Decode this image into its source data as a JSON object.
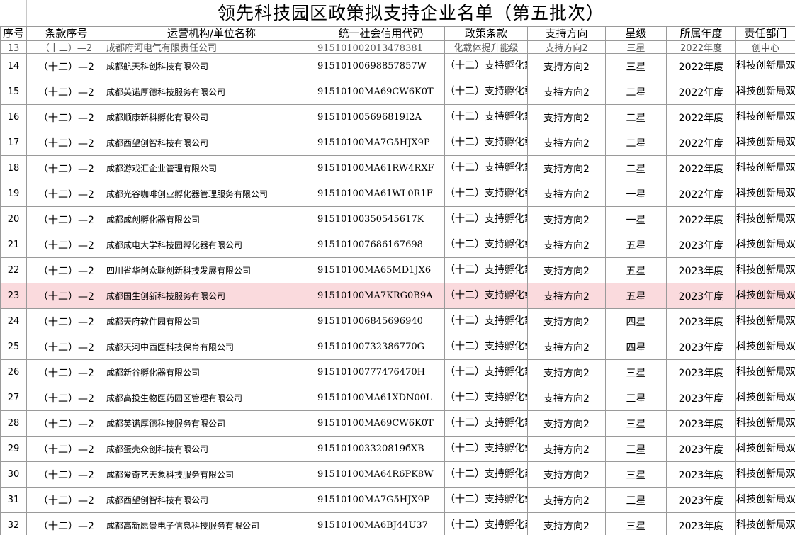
{
  "title": "领先科技园区政策拟支持企业名单（第五批次）",
  "headers": [
    "序号",
    "条款序号",
    "运营机构/单位名称",
    "统一社会信用代码",
    "政策条款",
    "支持方向",
    "星级",
    "所属年度",
    "责任部门"
  ],
  "partial_row": {
    "idx": "13",
    "clause": "（十二）—2",
    "name": "成都府河电气有限责任公司",
    "code": "915101002013478381",
    "terms": "化载体提升能级",
    "direction": "支持方向2",
    "star": "三星",
    "year": "2022年度",
    "dept": "创中心"
  },
  "rows": [
    {
      "idx": "14",
      "clause": "（十二）—2",
      "name": "成都航天科创科技有限公司",
      "code": "91510100698857857W",
      "terms": "（十二）支持孵化载体提升能级",
      "direction": "支持方向2",
      "star": "三星",
      "year": "2022年度",
      "dept": "科技创新局双创中心"
    },
    {
      "idx": "15",
      "clause": "（十二）—2",
      "name": "成都英诺厚德科技服务有限公司",
      "code": "91510100MA69CW6K0T",
      "terms": "（十二）支持孵化载体提升能级",
      "direction": "支持方向2",
      "star": "二星",
      "year": "2022年度",
      "dept": "科技创新局双创中心"
    },
    {
      "idx": "16",
      "clause": "（十二）—2",
      "name": "成都顺康新科孵化有限公司",
      "code": "915101005696819I2A",
      "terms": "（十二）支持孵化载体提升能级",
      "direction": "支持方向2",
      "star": "二星",
      "year": "2022年度",
      "dept": "科技创新局双创中心"
    },
    {
      "idx": "17",
      "clause": "（十二）—2",
      "name": "成都西望创智科技有限公司",
      "code": "91510100MA7G5HJX9P",
      "terms": "（十二）支持孵化载体提升能级",
      "direction": "支持方向2",
      "star": "二星",
      "year": "2022年度",
      "dept": "科技创新局双创中心"
    },
    {
      "idx": "18",
      "clause": "（十二）—2",
      "name": "成都游戏汇企业管理有限公司",
      "code": "91510100MA61RW4RXF",
      "terms": "（十二）支持孵化载体提升能级",
      "direction": "支持方向2",
      "star": "二星",
      "year": "2022年度",
      "dept": "科技创新局双创中心"
    },
    {
      "idx": "19",
      "clause": "（十二）—2",
      "name": "成都光谷咖啡创业孵化器管理服务有限公司",
      "code": "91510100MA61WL0R1F",
      "terms": "（十二）支持孵化载体提升能级",
      "direction": "支持方向2",
      "star": "一星",
      "year": "2022年度",
      "dept": "科技创新局双创中心"
    },
    {
      "idx": "20",
      "clause": "（十二）—2",
      "name": "成都成创孵化器有限公司",
      "code": "91510100350545617K",
      "terms": "（十二）支持孵化载体提升能级",
      "direction": "支持方向2",
      "star": "一星",
      "year": "2022年度",
      "dept": "科技创新局双创中心"
    },
    {
      "idx": "21",
      "clause": "（十二）—2",
      "name": "成都成电大学科技园孵化器有限公司",
      "code": "915101007686167698",
      "terms": "（十二）支持孵化载体提升能级",
      "direction": "支持方向2",
      "star": "五星",
      "year": "2023年度",
      "dept": "科技创新局双创中心"
    },
    {
      "idx": "22",
      "clause": "（十二）—2",
      "name": "四川省华创众联创新科技发展有限公司",
      "code": "91510100MA65MD1JX6",
      "terms": "（十二）支持孵化载体提升能级",
      "direction": "支持方向2",
      "star": "五星",
      "year": "2023年度",
      "dept": "科技创新局双创中心"
    },
    {
      "idx": "23",
      "clause": "（十二）—2",
      "name": "成都国生创新科技服务有限公司",
      "code": "91510100MA7KRG0B9A",
      "terms": "（十二）支持孵化载体提升能级",
      "direction": "支持方向2",
      "star": "五星",
      "year": "2023年度",
      "dept": "科技创新局双创中心"
    },
    {
      "idx": "24",
      "clause": "（十二）—2",
      "name": "成都天府软件园有限公司",
      "code": "915101006845696940",
      "terms": "（十二）支持孵化载体提升能级",
      "direction": "支持方向2",
      "star": "四星",
      "year": "2023年度",
      "dept": "科技创新局双创中心"
    },
    {
      "idx": "25",
      "clause": "（十二）—2",
      "name": "成都天河中西医科技保育有限公司",
      "code": "91510100732386770G",
      "terms": "（十二）支持孵化载体提升能级",
      "direction": "支持方向2",
      "star": "四星",
      "year": "2023年度",
      "dept": "科技创新局双创中心"
    },
    {
      "idx": "26",
      "clause": "（十二）—2",
      "name": "成都新谷孵化器有限公司",
      "code": "91510100777476470H",
      "terms": "（十二）支持孵化载体提升能级",
      "direction": "支持方向2",
      "star": "三星",
      "year": "2023年度",
      "dept": "科技创新局双创中心"
    },
    {
      "idx": "27",
      "clause": "（十二）—2",
      "name": "成都高投生物医药园区管理有限公司",
      "code": "91510100MA61XDN00L",
      "terms": "（十二）支持孵化载体提升能级",
      "direction": "支持方向2",
      "star": "三星",
      "year": "2023年度",
      "dept": "科技创新局双创中心"
    },
    {
      "idx": "28",
      "clause": "（十二）—2",
      "name": "成都英诺厚德科技服务有限公司",
      "code": "91510100MA69CW6K0T",
      "terms": "（十二）支持孵化载体提升能级",
      "direction": "支持方向2",
      "star": "三星",
      "year": "2023年度",
      "dept": "科技创新局双创中心"
    },
    {
      "idx": "29",
      "clause": "（十二）—2",
      "name": "成都蛋壳众创科技有限公司",
      "code": "915101003320819бXB",
      "terms": "（十二）支持孵化载体提升能级",
      "direction": "支持方向2",
      "star": "三星",
      "year": "2023年度",
      "dept": "科技创新局双创中心"
    },
    {
      "idx": "30",
      "clause": "（十二）—2",
      "name": "成都爱奇艺天象科技服务有限公司",
      "code": "91510100MA64R6PK8W",
      "terms": "（十二）支持孵化载体提升能级",
      "direction": "支持方向2",
      "star": "三星",
      "year": "2023年度",
      "dept": "科技创新局双创中心"
    },
    {
      "idx": "31",
      "clause": "（十二）—2",
      "name": "成都西望创智科技有限公司",
      "code": "91510100MA7G5HJX9P",
      "terms": "（十二）支持孵化载体提升能级",
      "direction": "支持方向2",
      "star": "三星",
      "year": "2023年度",
      "dept": "科技创新局双创中心"
    },
    {
      "idx": "32",
      "clause": "（十二）—2",
      "name": "成都高新愿景电子信息科技服务有限公司",
      "code": "91510100MA6BJ44U37",
      "terms": "（十二）支持孵化载体提升能级",
      "direction": "支持方向2",
      "star": "三星",
      "year": "2023年度",
      "dept": "科技创新局双创中心"
    }
  ],
  "highlight_idx": "23",
  "colors": {
    "highlight": "#fadadd",
    "grid": "#9a9a9a"
  }
}
